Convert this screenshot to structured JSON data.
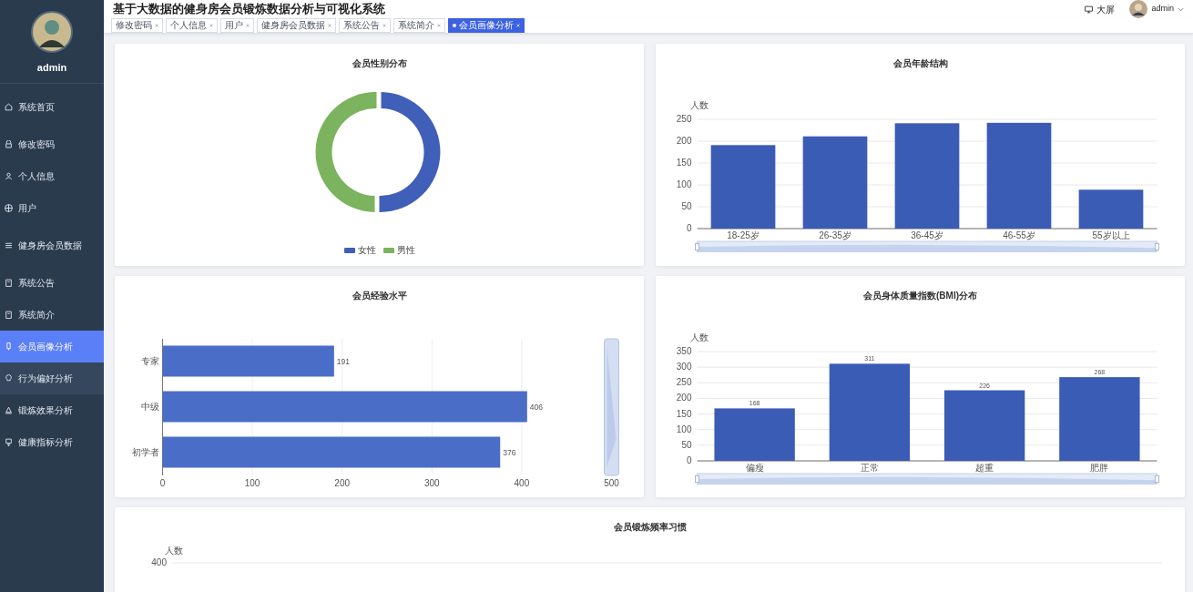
{
  "sidebar": {
    "user": "admin",
    "items": [
      {
        "label": "系统首页",
        "selected": false,
        "hovered": false
      },
      {
        "label": "修改密码",
        "selected": false,
        "hovered": false
      },
      {
        "label": "个人信息",
        "selected": false,
        "hovered": false
      },
      {
        "label": "用户",
        "selected": false,
        "hovered": false
      },
      {
        "label": "健身房会员数据",
        "selected": false,
        "hovered": false
      },
      {
        "label": "系统公告",
        "selected": false,
        "hovered": false
      },
      {
        "label": "系统简介",
        "selected": false,
        "hovered": false
      },
      {
        "label": "会员画像分析",
        "selected": true,
        "hovered": false
      },
      {
        "label": "行为偏好分析",
        "selected": false,
        "hovered": true
      },
      {
        "label": "锻炼效果分析",
        "selected": false,
        "hovered": false
      },
      {
        "label": "健康指标分析",
        "selected": false,
        "hovered": false
      }
    ]
  },
  "header": {
    "title": "基于大数据的健身房会员锻炼数据分析与可视化系统",
    "screen_link": "大屏",
    "user": "admin"
  },
  "tabs": [
    {
      "label": "修改密码",
      "selected": false
    },
    {
      "label": "个人信息",
      "selected": false
    },
    {
      "label": "用户",
      "selected": false
    },
    {
      "label": "健身房会员数据",
      "selected": false
    },
    {
      "label": "系统公告",
      "selected": false
    },
    {
      "label": "系统简介",
      "selected": false
    },
    {
      "label": "会员画像分析",
      "selected": true
    }
  ],
  "gender_chart": {
    "title": "会员性别分布",
    "legend": [
      {
        "name": "女性",
        "color": "#3f5fb8"
      },
      {
        "name": "男性",
        "color": "#7cb35e"
      }
    ]
  },
  "age_chart": {
    "chart_data": {
      "type": "bar",
      "title": "会员年龄结构",
      "ylabel": "人数",
      "categories": [
        "18-25岁",
        "26-35岁",
        "36-45岁",
        "46-55岁",
        "55岁以上"
      ],
      "series": [
        {
          "color": "#3b5cb5",
          "values": [
            191,
            211,
            241,
            242,
            89
          ]
        }
      ],
      "ylim": [
        0,
        250
      ],
      "yticks": [
        0,
        50,
        100,
        150,
        200,
        250
      ],
      "grid": true
    }
  },
  "experience_chart": {
    "chart_data": {
      "type": "bar",
      "orientation": "horizontal",
      "title": "会员经验水平",
      "categories": [
        "专家",
        "中级",
        "初学者"
      ],
      "series": [
        {
          "color": "#4a6dc8",
          "values": [
            191,
            406,
            376
          ]
        }
      ],
      "xlim": [
        0,
        500
      ],
      "xticks": [
        0,
        100,
        200,
        300,
        400,
        500
      ],
      "data_labels": true,
      "grid": true
    }
  },
  "bmi_chart": {
    "chart_data": {
      "type": "bar",
      "title": "会员身体质量指数(BMI)分布",
      "ylabel": "人数",
      "categories": [
        "偏瘦",
        "正常",
        "超重",
        "肥胖"
      ],
      "series": [
        {
          "color": "#3b5cb5",
          "values": [
            168,
            311,
            226,
            268
          ]
        }
      ],
      "ylim": [
        0,
        350
      ],
      "yticks": [
        0,
        50,
        100,
        150,
        200,
        250,
        300,
        350
      ],
      "data_labels": true,
      "grid": true
    }
  },
  "frequency_chart": {
    "title": "会员锻炼频率习惯",
    "ylabel": "人数",
    "ytick": "400"
  }
}
